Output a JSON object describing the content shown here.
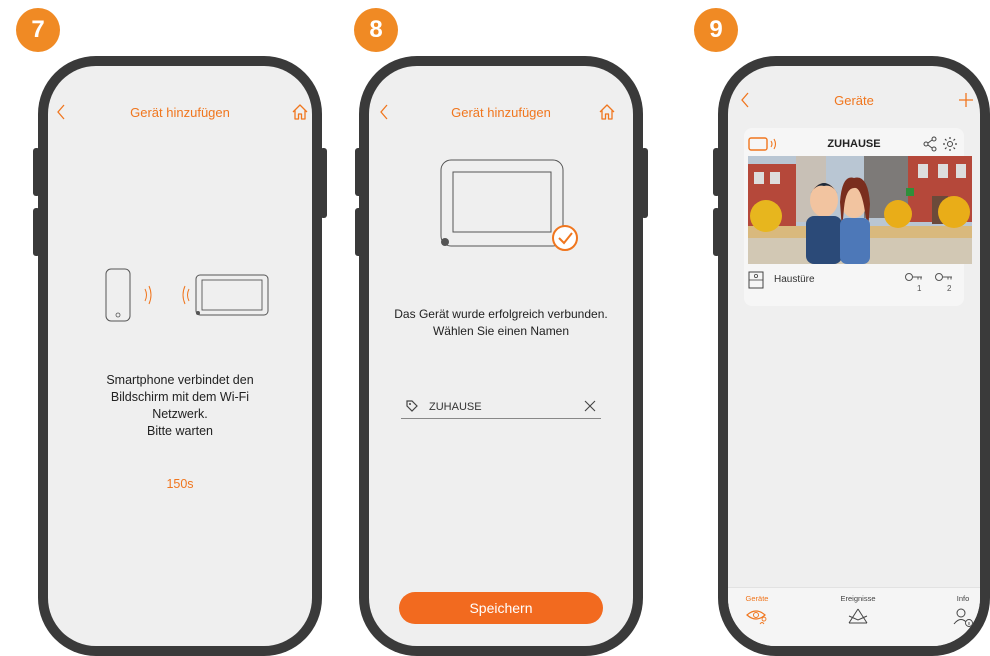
{
  "steps": [
    {
      "number": "7",
      "header_title": "Gerät hinzufügen",
      "message_lines": [
        "Smartphone verbindet den",
        "Bildschirm mit dem Wi-Fi",
        "Netzwerk.",
        "Bitte warten"
      ],
      "countdown": "150s"
    },
    {
      "number": "8",
      "header_title": "Gerät hinzufügen",
      "message_lines": [
        "Das Gerät wurde erfolgreich verbunden.",
        "Wählen Sie einen Namen"
      ],
      "name_field_value": "ZUHAUSE",
      "save_button": "Speichern"
    },
    {
      "number": "9",
      "header_title": "Geräte",
      "device_card": {
        "name": "ZUHAUSE",
        "door_label": "Haustüre",
        "key_numbers": [
          "1",
          "2"
        ]
      },
      "bottom_nav": [
        {
          "label": "Geräte",
          "active": true
        },
        {
          "label": "Ereignisse",
          "active": false
        },
        {
          "label": "Info",
          "active": false
        }
      ]
    }
  ],
  "colors": {
    "accent": "#f0761e",
    "badge": "#f08a24",
    "phone_frame": "#3a3a3a",
    "screen_bg": "#efefef",
    "button": "#f26a1f"
  }
}
